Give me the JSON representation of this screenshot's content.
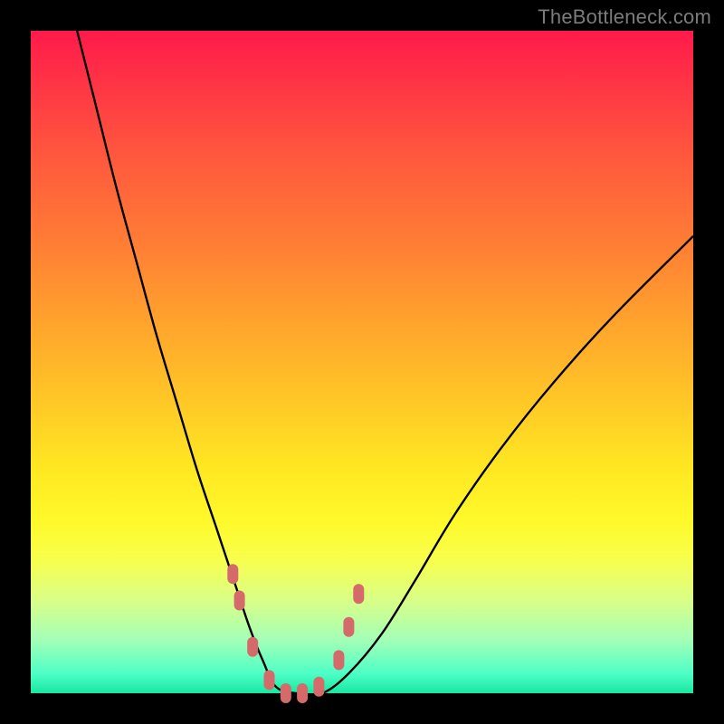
{
  "watermark": "TheBottleneck.com",
  "colors": {
    "background": "#000000",
    "curve": "#000000",
    "marker": "#d46a6a"
  },
  "chart_data": {
    "type": "line",
    "title": "",
    "xlabel": "",
    "ylabel": "",
    "xlim": [
      0,
      100
    ],
    "ylim": [
      0,
      100
    ],
    "grid": false,
    "series": [
      {
        "name": "bottleneck-curve",
        "x": [
          7,
          10,
          13,
          16,
          19,
          22,
          25,
          28,
          31,
          33,
          35,
          37,
          40,
          44,
          48,
          53,
          58,
          64,
          71,
          79,
          88,
          100
        ],
        "y": [
          100,
          88,
          76,
          65,
          54,
          44,
          34,
          25,
          16,
          10,
          5,
          1,
          0,
          0,
          3,
          9,
          17,
          27,
          37,
          47,
          57,
          69
        ]
      }
    ],
    "annotations": [
      {
        "name": "trough-markers",
        "type": "scatter",
        "x": [
          30.5,
          31.5,
          33.5,
          36,
          38.5,
          41,
          43.5,
          46.5,
          48,
          49.5
        ],
        "y": [
          18,
          14,
          7,
          2,
          0,
          0,
          1,
          5,
          10,
          15
        ]
      }
    ]
  }
}
